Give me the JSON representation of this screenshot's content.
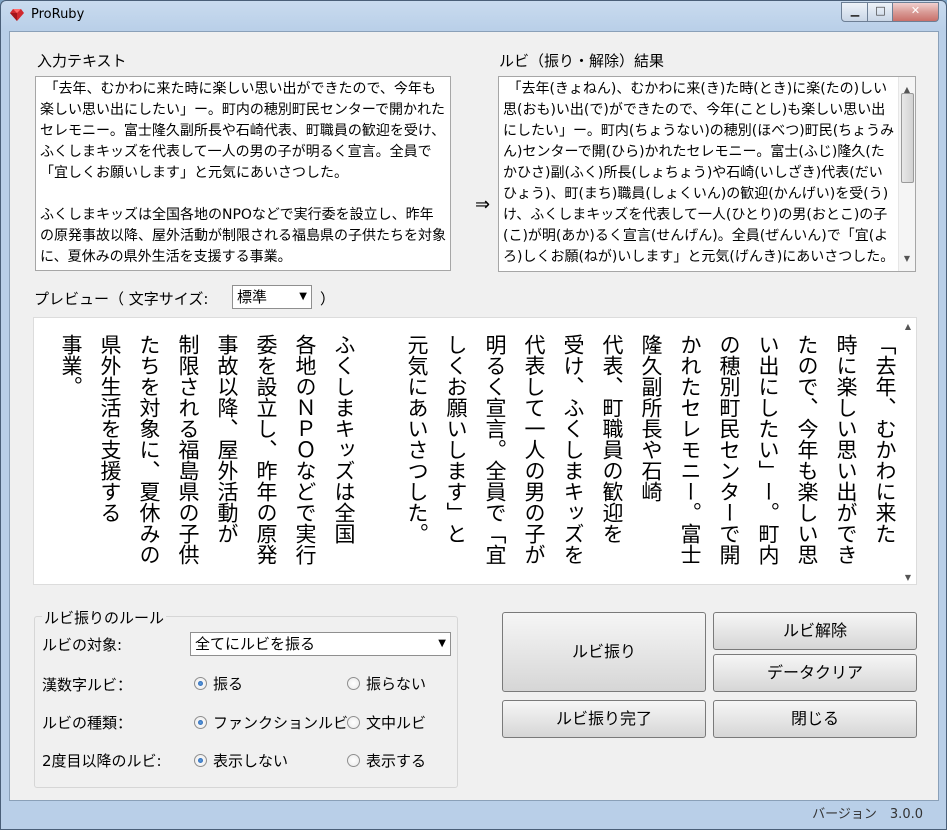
{
  "window": {
    "title": "ProRuby"
  },
  "input": {
    "heading": "入力テキスト",
    "paragraphs": [
      " 「去年、むかわに来た時に楽しい思い出ができたので、今年も楽しい思い出にしたい」ー。町内の穂別町民センターで開かれたセレモニー。富士隆久副所長や石崎代表、町職員の歓迎を受け、ふくしまキッズを代表して一人の男の子が明るく宣言。全員で「宜しくお願いします」と元気にあいさつした。",
      "ふくしまキッズは全国各地のNPOなどで実行委を設立し、昨年の原発事故以降、屋外活動が制限される福島県の子供たちを対象に、夏休みの県外生活を支援する事業。"
    ]
  },
  "arrow": "⇒",
  "result": {
    "heading": "ルビ（振り・解除）結果",
    "text": " 「去年(きょねん)、むかわに来(き)た時(とき)に楽(たの)しい思(おも)い出(で)ができたので、今年(ことし)も楽しい思い出にしたい」ー。町内(ちょうない)の穂別(ほべつ)町民(ちょうみん)センターで開(ひら)かれたセレモニー。富士(ふじ)隆久(たかひさ)副(ふく)所長(しょちょう)や石崎(いしざき)代表(だいひょう)、町(まち)職員(しょくいん)の歓迎(かんげい)を受(う)け、ふくしまキッズを代表して一人(ひとり)の男(おとこ)の子(こ)が明(あか)るく宣言(せんげん)。全員(ぜんいん)で「宜(よろ)しくお願(ねが)いします」と元気(げんき)にあいさつした。"
  },
  "preview": {
    "label": "プレビュー（ 文字サイズ:",
    "label_close": "）",
    "size_selected": "標準",
    "columns": [
      "「去年、むかわに来た",
      "時に楽しい思い出ができ",
      "たので、今年も楽しい思",
      "い出にしたい」ー。町内",
      "の穂別町民センターで開",
      "かれたセレモニー。富士",
      "隆久副所長や石崎",
      "代表、町職員の歓迎を",
      "受け、ふくしまキッズを",
      "代表して一人の男の子が",
      "明るく宣言。全員で「宜",
      "しくお願いします」と",
      "元気にあいさつした。",
      "ふくしまキッズは全国",
      "各地のＮＰＯなどで実行",
      "委を設立し、昨年の原発",
      "事故以降、屋外活動が",
      "制限される福島県の子供",
      "たちを対象に、夏休みの",
      "県外生活を支援する",
      "事業。"
    ]
  },
  "rules": {
    "title": "ルビ振りのルール",
    "target_label": "ルビの対象:",
    "target_selected": "全てにルビを振る",
    "rows": [
      {
        "label": "漢数字ルビ：",
        "opt1": "振る",
        "opt2": "振らない",
        "selected": 1
      },
      {
        "label": "ルビの種類：",
        "opt1": "ファンクションルビ",
        "opt2": "文中ルビ",
        "selected": 1
      },
      {
        "label": "2度目以降のルビ:",
        "opt1": "表示しない",
        "opt2": "表示する",
        "selected": 1
      }
    ]
  },
  "buttons": {
    "ruby": "ルビ振り",
    "unruby": "ルビ解除",
    "clear": "データクリア",
    "done": "ルビ振り完了",
    "close": "閉じる"
  },
  "status": {
    "version": "バージョン　3.0.0"
  }
}
